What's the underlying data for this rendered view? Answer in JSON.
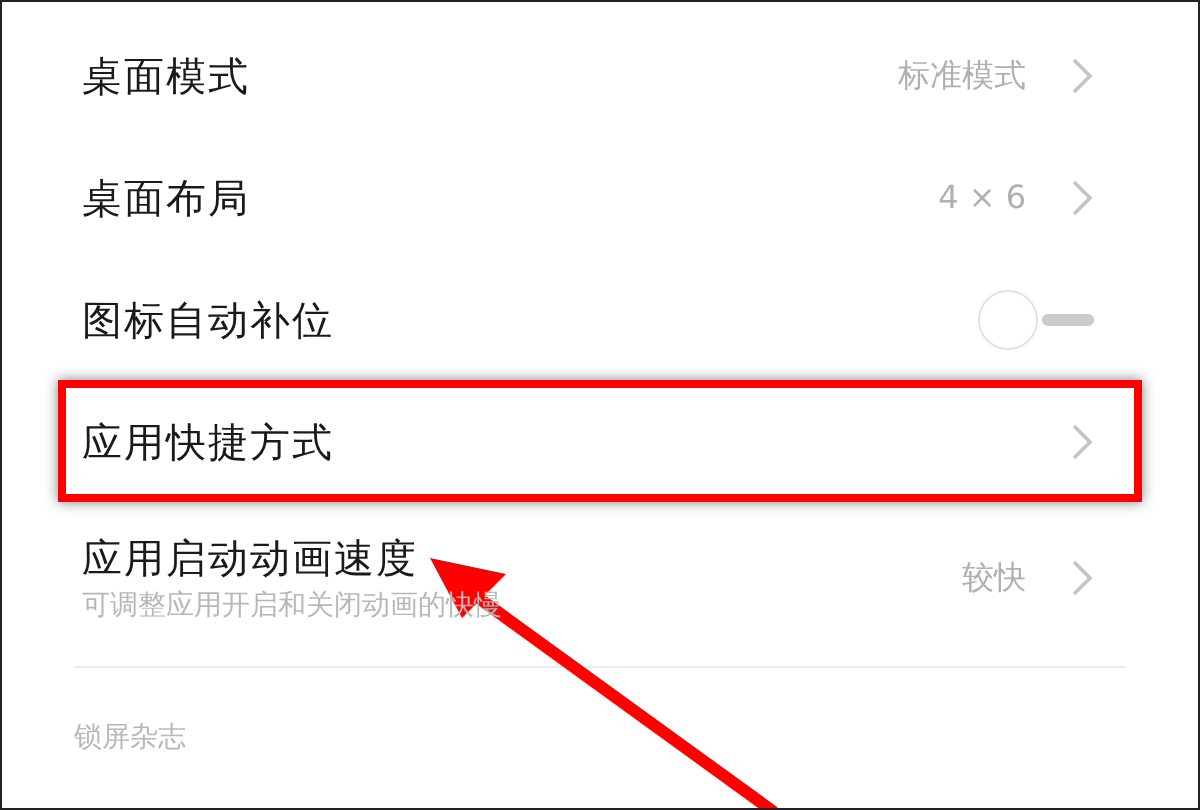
{
  "settings": [
    {
      "kind": "link",
      "title": "桌面模式",
      "value": "标准模式",
      "highlighted": false
    },
    {
      "kind": "link",
      "title": "桌面布局",
      "value": "4 × 6",
      "highlighted": false
    },
    {
      "kind": "toggle",
      "title": "图标自动补位",
      "on": false,
      "highlighted": false
    },
    {
      "kind": "link",
      "title": "应用快捷方式",
      "highlighted": true
    },
    {
      "kind": "link",
      "title": "应用启动动画速度",
      "subtitle": "可调整应用开启和关闭动画的快慢",
      "value": "较快",
      "highlighted": false
    }
  ],
  "section_header": "锁屏杂志"
}
